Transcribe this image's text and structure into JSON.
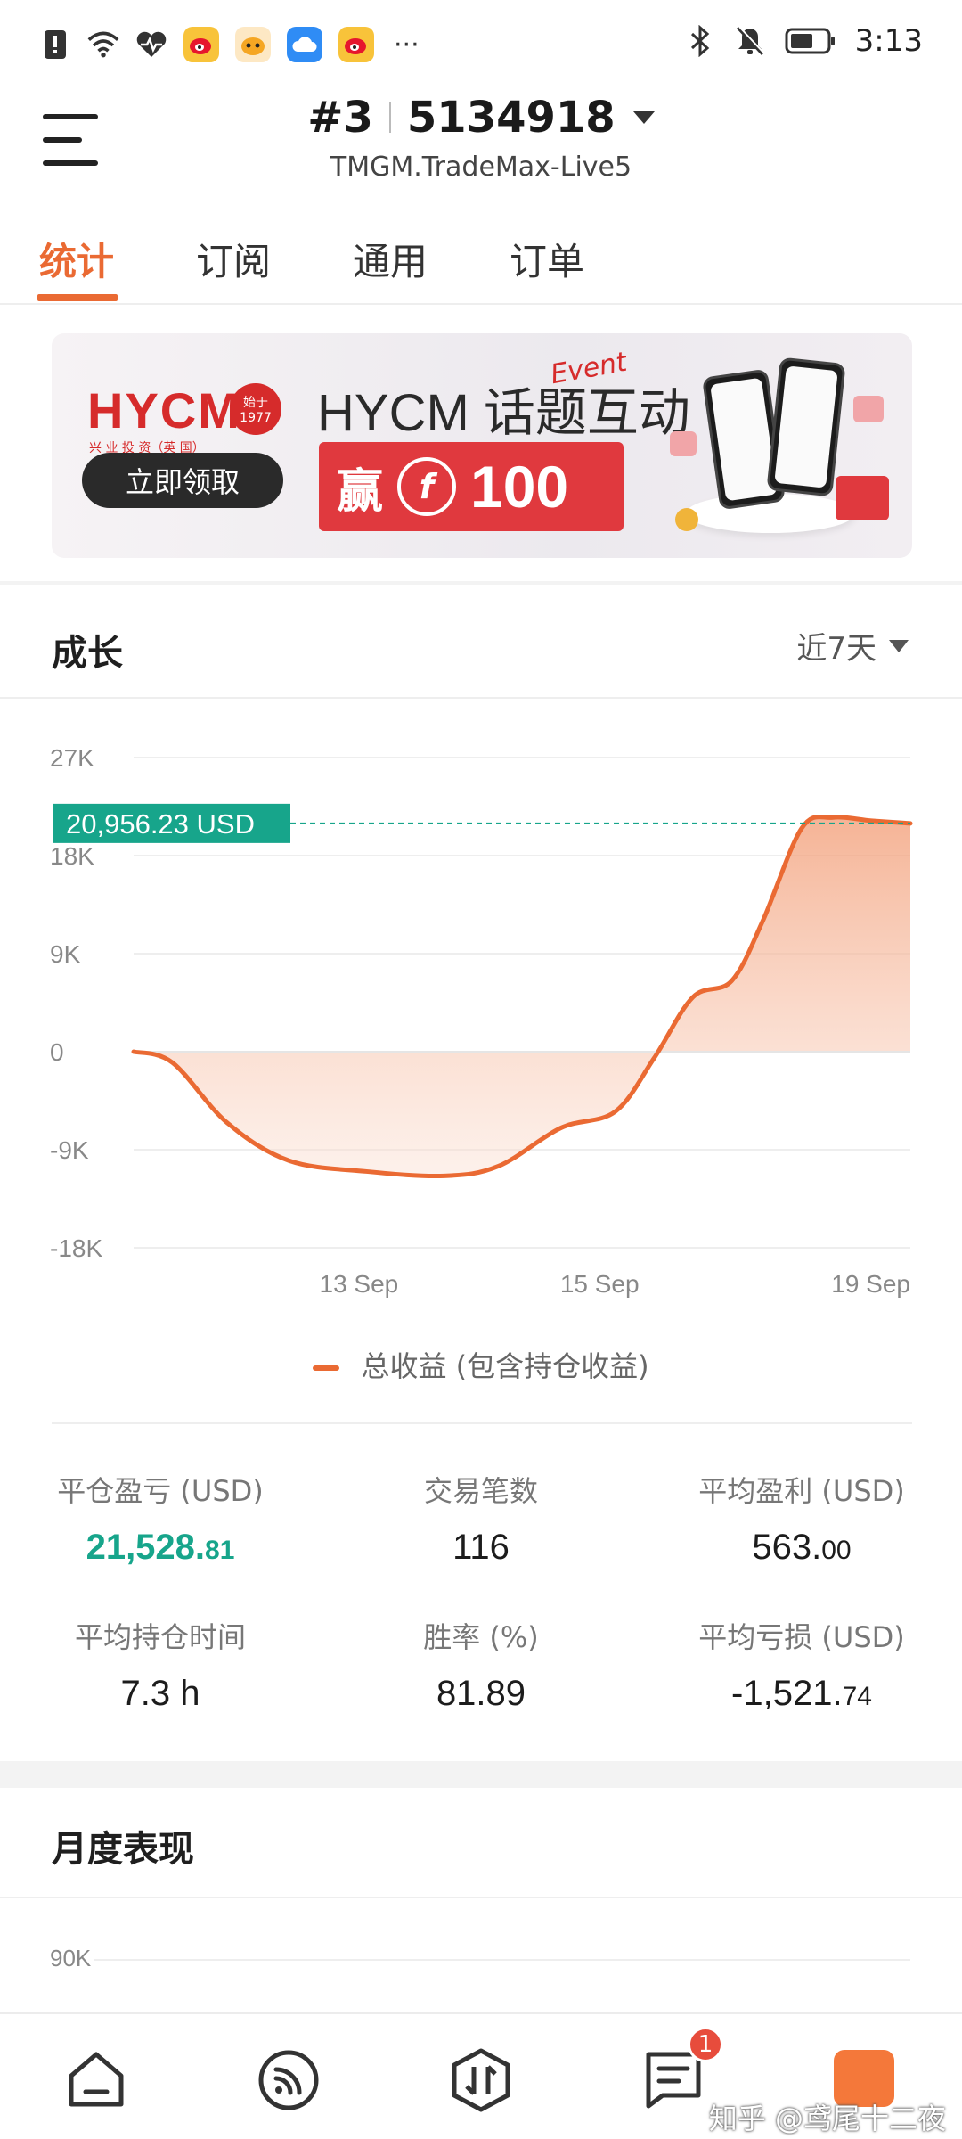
{
  "status_bar": {
    "time": "3:13",
    "more": "···",
    "left_icons": [
      "alert-icon",
      "wifi-icon",
      "health-icon",
      "weibo-icon",
      "bilibili-icon",
      "cloud-icon",
      "weibo-icon"
    ],
    "right_icons": [
      "bluetooth-icon",
      "mute-bell-icon",
      "battery-icon"
    ]
  },
  "header": {
    "account_number": "#3",
    "account_id": "5134918",
    "server": "TMGM.TradeMax-Live5"
  },
  "tabs": [
    {
      "label": "统计",
      "active": true
    },
    {
      "label": "订阅",
      "active": false
    },
    {
      "label": "通用",
      "active": false
    },
    {
      "label": "订单",
      "active": false
    }
  ],
  "banner": {
    "brand": "HYCM",
    "brand_sub": "兴 业 投 资（英 国）",
    "seal_top": "始于",
    "seal_year": "1977",
    "cta": "立即领取",
    "title": "HYCM 话题互动",
    "script": "Event",
    "win_char": "赢",
    "coin_symbol": "f",
    "amount": "100"
  },
  "growth": {
    "title": "成长",
    "range": "近7天",
    "current_value_label": "20,956.23 USD",
    "legend": "总收益 (包含持仓收益)"
  },
  "chart_data": {
    "type": "area",
    "title": "",
    "x_ticks": [
      "13 Sep",
      "15 Sep",
      "19 Sep"
    ],
    "y_ticks": [
      "27K",
      "18K",
      "9K",
      "0",
      "-9K",
      "-18K"
    ],
    "ylim": [
      -18000,
      27000
    ],
    "series": [
      {
        "name": "总收益 (包含持仓收益)",
        "color": "#ea6a33",
        "points": [
          {
            "x": 0.0,
            "y": 0
          },
          {
            "x": 0.05,
            "y": -1000
          },
          {
            "x": 0.12,
            "y": -6500
          },
          {
            "x": 0.2,
            "y": -10000
          },
          {
            "x": 0.3,
            "y": -11000
          },
          {
            "x": 0.4,
            "y": -11400
          },
          {
            "x": 0.47,
            "y": -10500
          },
          {
            "x": 0.55,
            "y": -7000
          },
          {
            "x": 0.62,
            "y": -5500
          },
          {
            "x": 0.67,
            "y": -600
          },
          {
            "x": 0.72,
            "y": 5000
          },
          {
            "x": 0.77,
            "y": 6500
          },
          {
            "x": 0.81,
            "y": 12000
          },
          {
            "x": 0.86,
            "y": 20500
          },
          {
            "x": 0.9,
            "y": 21500
          },
          {
            "x": 0.95,
            "y": 21200
          },
          {
            "x": 1.0,
            "y": 20956
          }
        ]
      }
    ],
    "current_value": 20956.23,
    "grid": true
  },
  "stats": [
    {
      "label": "平仓盈亏 (USD)",
      "int": "21,528.",
      "dec": "81",
      "green": true
    },
    {
      "label": "交易笔数",
      "int": "116",
      "dec": "",
      "green": false
    },
    {
      "label": "平均盈利 (USD)",
      "int": "563.",
      "dec": "00",
      "green": false
    },
    {
      "label": "平均持仓时间",
      "int": "7.3 h",
      "dec": "",
      "green": false
    },
    {
      "label": "胜率 (%)",
      "int": "81.89",
      "dec": "",
      "green": false
    },
    {
      "label": "平均亏损 (USD)",
      "int": "-1,521.",
      "dec": "74",
      "green": false
    }
  ],
  "monthly": {
    "title": "月度表现",
    "y_top": "90K"
  },
  "bottom_nav": [
    {
      "name": "home-icon"
    },
    {
      "name": "signal-icon"
    },
    {
      "name": "trade-icon"
    },
    {
      "name": "orders-icon",
      "badge": "1"
    }
  ],
  "watermark": "知乎 @鸢尾十二夜"
}
